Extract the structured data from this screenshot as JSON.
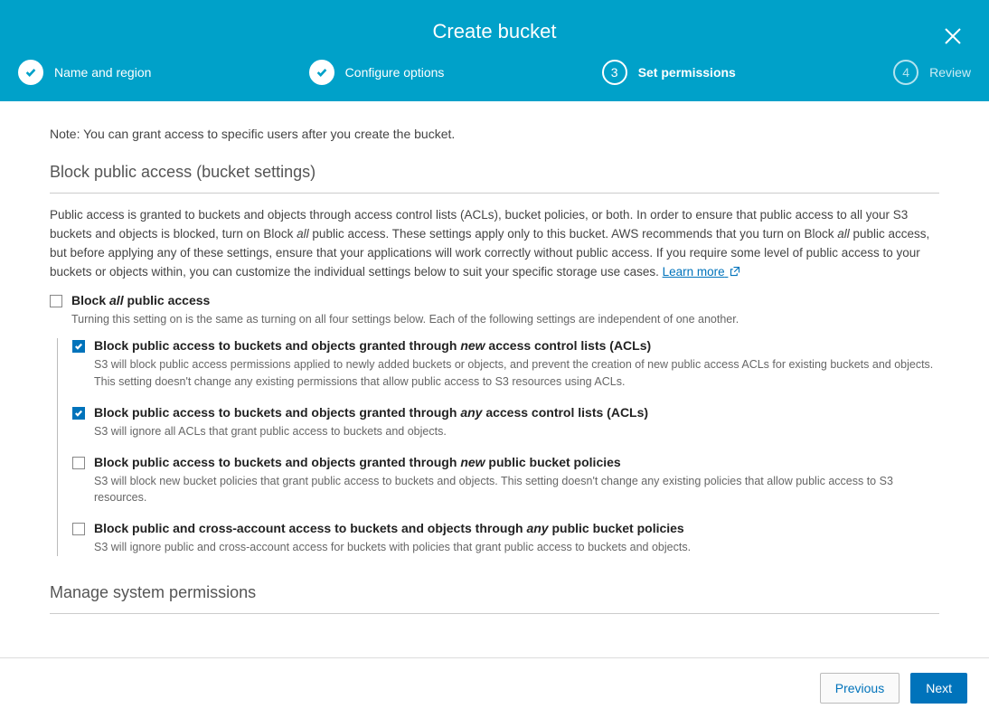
{
  "header": {
    "title": "Create bucket"
  },
  "steps": {
    "s1": {
      "label": "Name and region"
    },
    "s2": {
      "label": "Configure options"
    },
    "s3": {
      "label": "Set permissions",
      "num": "3"
    },
    "s4": {
      "label": "Review",
      "num": "4"
    }
  },
  "note": "Note: You can grant access to specific users after you create the bucket.",
  "blockPublic": {
    "title": "Block public access (bucket settings)",
    "desc_pre": "Public access is granted to buckets and objects through access control lists (ACLs), bucket policies, or both. In order to ensure that public access to all your S3 buckets and objects is blocked, turn on Block ",
    "desc_em1": "all",
    "desc_mid": " public access. These settings apply only to this bucket. AWS recommends that you turn on Block ",
    "desc_em2": "all",
    "desc_post": " public access, but before applying any of these settings, ensure that your applications will work correctly without public access. If you require some level of public access to your buckets or objects within, you can customize the individual settings below to suit your specific storage use cases. ",
    "learn_more": "Learn more",
    "master": {
      "label_pre": "Block ",
      "label_em": "all",
      "label_post": " public access",
      "sub": "Turning this setting on is the same as turning on all four settings below. Each of the following settings are independent of one another."
    },
    "c1": {
      "checked": true,
      "label_pre": "Block public access to buckets and objects granted through ",
      "label_em": "new",
      "label_post": " access control lists (ACLs)",
      "sub": "S3 will block public access permissions applied to newly added buckets or objects, and prevent the creation of new public access ACLs for existing buckets and objects. This setting doesn't change any existing permissions that allow public access to S3 resources using ACLs."
    },
    "c2": {
      "checked": true,
      "label_pre": "Block public access to buckets and objects granted through ",
      "label_em": "any",
      "label_post": " access control lists (ACLs)",
      "sub": "S3 will ignore all ACLs that grant public access to buckets and objects."
    },
    "c3": {
      "checked": false,
      "label_pre": "Block public access to buckets and objects granted through ",
      "label_em": "new",
      "label_post": " public bucket policies",
      "sub": "S3 will block new bucket policies that grant public access to buckets and objects. This setting doesn't change any existing policies that allow public access to S3 resources."
    },
    "c4": {
      "checked": false,
      "label_pre": "Block public and cross-account access to buckets and objects through ",
      "label_em": "any",
      "label_post": " public bucket policies",
      "sub": "S3 will ignore public and cross-account access for buckets with policies that grant public access to buckets and objects."
    }
  },
  "manageSystem": {
    "title": "Manage system permissions"
  },
  "footer": {
    "previous": "Previous",
    "next": "Next"
  }
}
